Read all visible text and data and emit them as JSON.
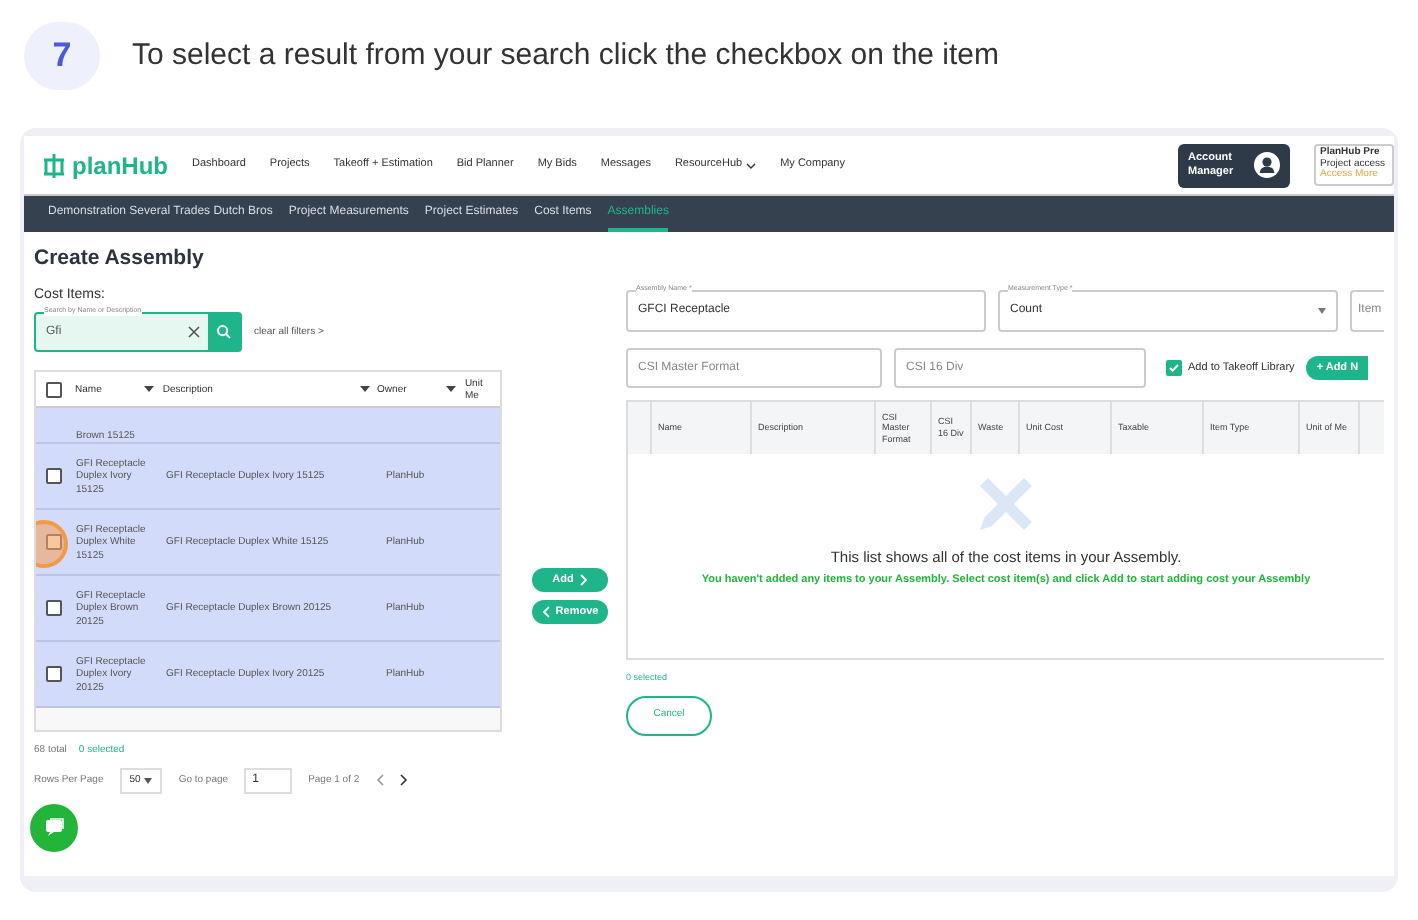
{
  "step": {
    "number": "7",
    "text": "To select a result from your search click the checkbox on the item"
  },
  "nav": {
    "logo": "planHub",
    "items": [
      {
        "label": "Dashboard",
        "dropdown": false
      },
      {
        "label": "Projects",
        "dropdown": false
      },
      {
        "label": "Takeoff + Estimation",
        "dropdown": false
      },
      {
        "label": "Bid Planner",
        "dropdown": false
      },
      {
        "label": "My Bids",
        "dropdown": false
      },
      {
        "label": "Messages",
        "dropdown": false
      },
      {
        "label": "ResourceHub",
        "dropdown": true
      },
      {
        "label": "My Company",
        "dropdown": false
      }
    ],
    "account_button": "Account Manager",
    "promo": {
      "title": "PlanHub Pre",
      "line": "Project access",
      "link": "Access More"
    }
  },
  "subnav": [
    {
      "label": "Demonstration Several Trades Dutch Bros",
      "selected": false
    },
    {
      "label": "Project Measurements",
      "selected": false
    },
    {
      "label": "Project Estimates",
      "selected": false
    },
    {
      "label": "Cost Items",
      "selected": false
    },
    {
      "label": "Assemblies",
      "selected": true
    }
  ],
  "page_title": "Create Assembly",
  "cost_items": {
    "label": "Cost Items:",
    "search": {
      "label": "Search by Name or Description",
      "value": "Gfi"
    },
    "clear_filters": "clear all filters >",
    "select_all_checked": false,
    "columns": [
      "Name",
      "Description",
      "Owner",
      "Unit Me"
    ],
    "rows": [
      {
        "name": "Brown 15125",
        "highlighted": true
      },
      {
        "name": "GFI Receptacle Duplex Ivory 15125",
        "description": "GFI Receptacle Duplex Ivory 15125",
        "owner": "PlanHub",
        "checked": false,
        "highlighted": true,
        "marked": false
      },
      {
        "name": "GFI Receptacle Duplex White 15125",
        "description": "GFI Receptacle Duplex White 15125",
        "owner": "PlanHub",
        "checked": false,
        "highlighted": true,
        "marked": true
      },
      {
        "name": "GFI Receptacle Duplex Brown 20125",
        "description": "GFI Receptacle Duplex Brown 20125",
        "owner": "PlanHub",
        "checked": false,
        "highlighted": true,
        "marked": false
      },
      {
        "name": "GFI Receptacle Duplex Ivory 20125",
        "description": "GFI Receptacle Duplex Ivory 20125",
        "owner": "PlanHub",
        "checked": false,
        "highlighted": true,
        "marked": false
      }
    ],
    "total": "68 total",
    "selected_count": "0 selected",
    "rows_per_page_label": "Rows Per Page",
    "rows_per_page": "50",
    "go_to_page_label": "Go to page",
    "page_value": "1",
    "page_info": "Page 1 of 2"
  },
  "transfer": {
    "add": "Add",
    "remove": "Remove"
  },
  "assembly": {
    "name_field": {
      "label": "Assembly Name *",
      "value": "GFCI Receptacle"
    },
    "measurement_field": {
      "label": "Measurement Type *",
      "value": "Count"
    },
    "item_field": {
      "placeholder": "Item"
    },
    "csi_master": {
      "placeholder": "CSI Master Format"
    },
    "csi_16": {
      "placeholder": "CSI 16 Div"
    },
    "takeoff_library": {
      "label": "Add to Takeoff Library",
      "checked": true
    },
    "add_new": "+ Add N",
    "columns": [
      "Name",
      "Description",
      "CSI Master Format",
      "CSI 16 Div",
      "Waste",
      "Unit Cost",
      "Taxable",
      "Item Type",
      "Unit of Me"
    ],
    "empty_title": "This list shows all of the cost items in your Assembly.",
    "empty_text": "You haven't added any items to your Assembly. Select cost item(s) and click Add to start adding cost your Assembly",
    "selected_count": "0 selected",
    "cancel": "Cancel"
  }
}
